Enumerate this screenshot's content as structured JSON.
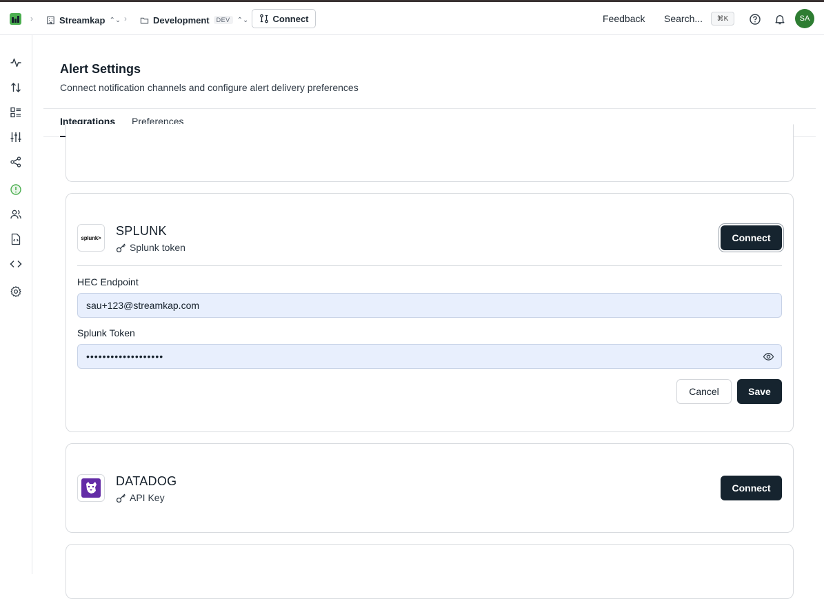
{
  "topbar": {
    "org": "Streamkap",
    "env": "Development",
    "env_badge": "DEV",
    "connect_label": "Connect",
    "feedback_label": "Feedback",
    "search_label": "Search...",
    "search_shortcut": "⌘K",
    "avatar_initials": "SA"
  },
  "sidebar": {
    "items": [
      {
        "icon": "activity-icon"
      },
      {
        "icon": "transfer-icon"
      },
      {
        "icon": "list-icon"
      },
      {
        "icon": "sliders-icon"
      },
      {
        "icon": "share-icon"
      },
      {
        "icon": "alert-icon",
        "active": true
      },
      {
        "icon": "users-icon"
      },
      {
        "icon": "file-code-icon"
      },
      {
        "icon": "code-icon"
      },
      {
        "icon": "settings-icon"
      }
    ]
  },
  "page": {
    "title": "Alert Settings",
    "subtitle": "Connect notification channels and configure alert delivery preferences"
  },
  "tabs": [
    {
      "label": "Integrations",
      "active": true
    },
    {
      "label": "Preferences",
      "active": false
    }
  ],
  "splunk": {
    "logo_text": "splunk>",
    "name": "SPLUNK",
    "auth": "Splunk token",
    "connect_label": "Connect",
    "hec_label": "HEC Endpoint",
    "hec_value": "sau+123@streamkap.com",
    "token_label": "Splunk Token",
    "token_value": "•••••••••••••••••••",
    "cancel_label": "Cancel",
    "save_label": "Save"
  },
  "datadog": {
    "name": "DATADOG",
    "auth": "API Key",
    "connect_label": "Connect"
  },
  "colors": {
    "accent_dark": "#16242f",
    "active_green": "#4caf50",
    "input_bg": "#e8effd"
  }
}
